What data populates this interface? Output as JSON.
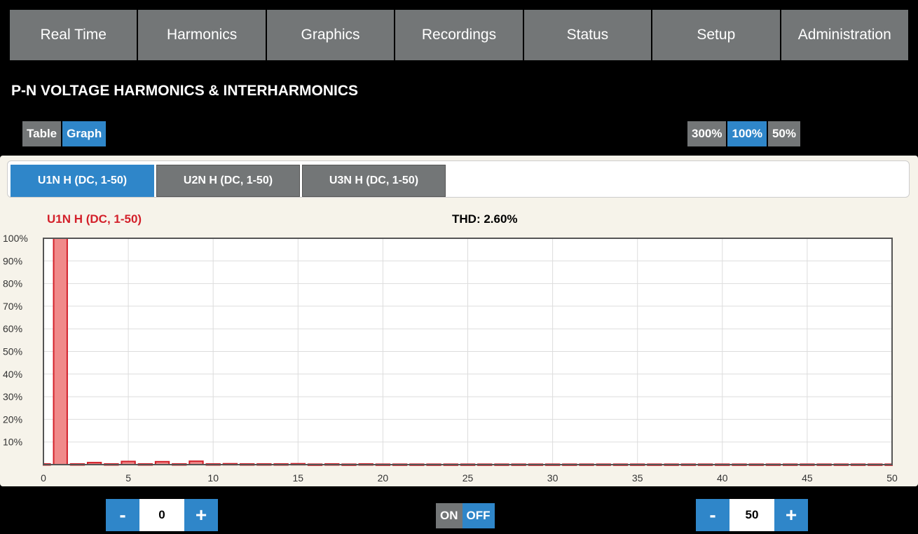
{
  "nav": {
    "items": [
      {
        "label": "Real Time"
      },
      {
        "label": "Harmonics"
      },
      {
        "label": "Graphics"
      },
      {
        "label": "Recordings"
      },
      {
        "label": "Status"
      },
      {
        "label": "Setup"
      },
      {
        "label": "Administration"
      }
    ]
  },
  "page": {
    "title": "P-N VOLTAGE HARMONICS & INTERHARMONICS"
  },
  "view_toggle": {
    "table_label": "Table",
    "graph_label": "Graph",
    "active": "Graph"
  },
  "zoom_toggle": {
    "options": [
      "300%",
      "100%",
      "50%"
    ],
    "active": "100%"
  },
  "tabs": [
    {
      "label": "U1N H (DC, 1-50)",
      "active": true
    },
    {
      "label": "U2N H (DC, 1-50)",
      "active": false
    },
    {
      "label": "U3N H (DC, 1-50)",
      "active": false
    }
  ],
  "chart_header": {
    "series_label": "U1N H (DC, 1-50)",
    "thd": "THD: 2.60%"
  },
  "chart_data": {
    "type": "bar",
    "title": "U1N H (DC, 1-50)",
    "xlim": [
      0,
      50
    ],
    "ylim": [
      0,
      100
    ],
    "x_ticks": [
      0,
      5,
      10,
      15,
      20,
      25,
      30,
      35,
      40,
      45,
      50
    ],
    "y_ticks": [
      "10%",
      "20%",
      "30%",
      "40%",
      "50%",
      "60%",
      "70%",
      "80%",
      "90%",
      "100%"
    ],
    "grid": true,
    "colors": {
      "bar_fill": "#f08a8a",
      "bar_stroke": "#d3202a"
    },
    "x": [
      0,
      1,
      2,
      3,
      4,
      5,
      6,
      7,
      8,
      9,
      10,
      11,
      12,
      13,
      14,
      15,
      16,
      17,
      18,
      19,
      20,
      21,
      22,
      23,
      24,
      25,
      26,
      27,
      28,
      29,
      30,
      31,
      32,
      33,
      34,
      35,
      36,
      37,
      38,
      39,
      40,
      41,
      42,
      43,
      44,
      45,
      46,
      47,
      48,
      49,
      50
    ],
    "values": [
      0.3,
      100,
      0.3,
      0.9,
      0.3,
      1.4,
      0.3,
      1.3,
      0.3,
      1.5,
      0.3,
      0.4,
      0.3,
      0.3,
      0.3,
      0.4,
      0.2,
      0.3,
      0.2,
      0.3,
      0.2,
      0.2,
      0.2,
      0.2,
      0.2,
      0.2,
      0.2,
      0.2,
      0.2,
      0.2,
      0.2,
      0.2,
      0.2,
      0.2,
      0.2,
      0.2,
      0.2,
      0.2,
      0.2,
      0.2,
      0.2,
      0.2,
      0.2,
      0.2,
      0.2,
      0.2,
      0.2,
      0.2,
      0.2,
      0.2,
      0.2
    ]
  },
  "controls": {
    "start": {
      "minus": "-",
      "value": "0",
      "plus": "+"
    },
    "end": {
      "minus": "-",
      "value": "50",
      "plus": "+"
    },
    "onoff": {
      "on": "ON",
      "off": "OFF",
      "active": "OFF"
    }
  }
}
